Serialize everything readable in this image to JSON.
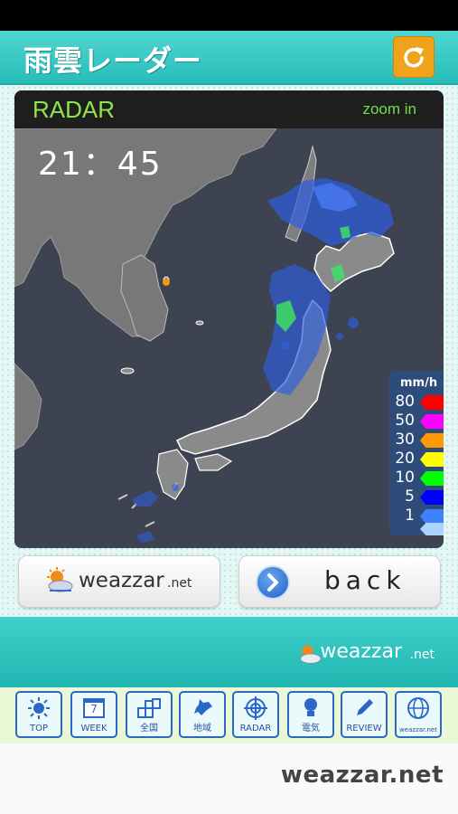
{
  "header": {
    "title": "雨雲レーダー",
    "refresh_icon": "refresh-icon"
  },
  "radar": {
    "label": "RADAR",
    "zoom_link": "zoom in",
    "time": "21：45",
    "legend": {
      "unit": "mm/h",
      "items": [
        {
          "value": "80",
          "color": "#ff0000"
        },
        {
          "value": "50",
          "color": "#ff00ff"
        },
        {
          "value": "30",
          "color": "#ff9900"
        },
        {
          "value": "20",
          "color": "#ffff00"
        },
        {
          "value": "10",
          "color": "#00ff00"
        },
        {
          "value": "5",
          "color": "#0000ff"
        },
        {
          "value": "1",
          "color": "#3f82ff"
        },
        {
          "value": "",
          "color": "#a9d4ff"
        }
      ]
    }
  },
  "buttons": {
    "weazzar_brand": "weazzar",
    "weazzar_suffix": ".net",
    "back_label": "back"
  },
  "footer": {
    "brand": "weazzar",
    "suffix": ".net"
  },
  "nav": [
    {
      "label": "TOP",
      "icon": "sun-icon"
    },
    {
      "label": "WEEK",
      "icon": "calendar-icon",
      "day": "7"
    },
    {
      "label": "全国",
      "icon": "grid-icon"
    },
    {
      "label": "地域",
      "icon": "hokkaido-map-icon"
    },
    {
      "label": "RADAR",
      "icon": "radar-target-icon"
    },
    {
      "label": "電気",
      "icon": "lightbulb-icon"
    },
    {
      "label": "REVIEW",
      "icon": "pencil-icon"
    },
    {
      "label": "weazzar.net",
      "icon": "globe-icon"
    }
  ],
  "bottom": {
    "logo": "weazzar.net"
  }
}
